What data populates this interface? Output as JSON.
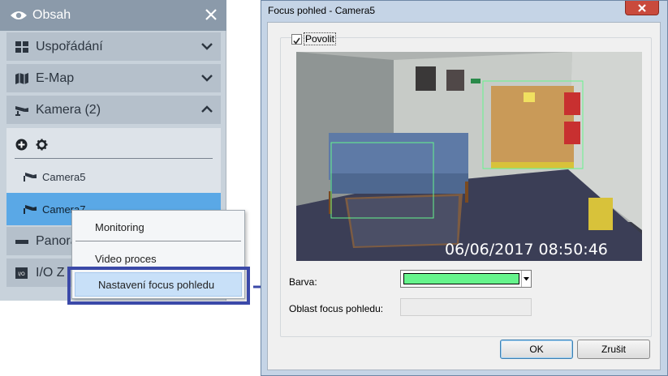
{
  "panel": {
    "title": "Obsah",
    "sections": [
      {
        "label": "Uspořádání",
        "icon": "layout-grid-icon",
        "chevron": "chevron-down-icon"
      },
      {
        "label": "E-Map",
        "icon": "map-icon",
        "chevron": "chevron-down-icon"
      },
      {
        "label": "Kamera (2)",
        "icon": "camera-icon",
        "chevron": "chevron-up-icon"
      },
      {
        "label": "Panora",
        "icon": "panorama-icon"
      },
      {
        "label": "I/O Z",
        "icon": "io-icon"
      }
    ],
    "cameras": [
      "Camera5",
      "Camera7"
    ],
    "toolbar": [
      "add-icon",
      "gear-icon"
    ]
  },
  "context_menu": {
    "items": [
      "Monitoring",
      "Video proces",
      "Nastavení focus pohledu"
    ],
    "highlighted_item": "Nastavení focus pohledu"
  },
  "dialog": {
    "title": "Focus pohled - Camera5",
    "enable_label": "Povolit",
    "enable_checked": true,
    "video_timestamp": "06/06/2017 08:50:46",
    "color_label": "Barva:",
    "color_value": "#66f48c",
    "area_label": "Oblast focus pohledu:",
    "area_value": "",
    "ok_label": "OK",
    "cancel_label": "Zrušit"
  },
  "colors": {
    "panel_header": "#8b9aaa",
    "selected_row": "#5aa8e6",
    "highlight_border": "#3b49a8",
    "focus_rect": "#66f48c"
  }
}
